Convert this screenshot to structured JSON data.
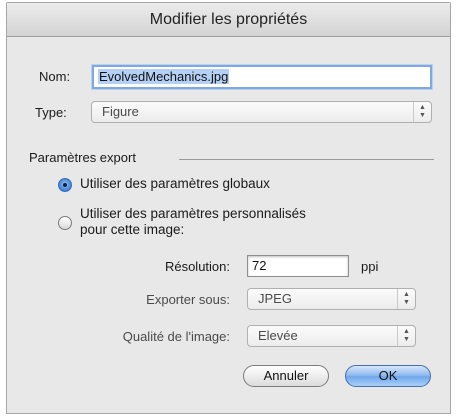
{
  "dialog": {
    "title": "Modifier les propriétés",
    "name_label": "Nom:",
    "name_value": "EvolvedMechanics.jpg",
    "type_label": "Type:",
    "type_value": "Figure",
    "export_section_label": "Paramètres export",
    "radio_global_label": "Utiliser des paramètres globaux",
    "radio_custom_label_line1": "Utiliser des paramètres personnalisés",
    "radio_custom_label_line2": "pour cette image:",
    "selected_radio": "global",
    "resolution_label": "Résolution:",
    "resolution_value": "72",
    "resolution_unit": "ppi",
    "export_as_label": "Exporter sous:",
    "export_as_value": "JPEG",
    "quality_label": "Qualité de l'image:",
    "quality_value": "Elevée",
    "cancel_label": "Annuler",
    "ok_label": "OK"
  },
  "colors": {
    "dialog_bg": "#e8e8e8",
    "focus_ring": "#7fa9de",
    "default_button": "#6ea6ea"
  },
  "icons": {
    "popup_arrows": "updown-arrows-icon"
  }
}
